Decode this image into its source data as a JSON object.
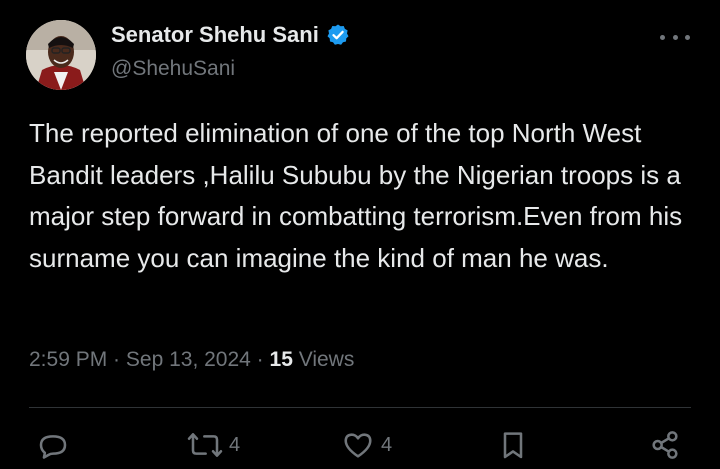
{
  "author": {
    "name": "Senator Shehu Sani",
    "handle": "@ShehuSani",
    "verified": true
  },
  "tweet": {
    "text": "The reported elimination of one of the top North West Bandit leaders ,Halilu Sububu by the Nigerian troops is a major step forward in combatting terrorism.Even from his surname you can imagine the kind of man he was."
  },
  "meta": {
    "time": "2:59 PM",
    "sep1": " · ",
    "date": "Sep 13, 2024",
    "sep2": " · ",
    "views_count": "15",
    "views_label": " Views"
  },
  "actions": {
    "reply_count": "",
    "retweet_count": "4",
    "like_count": "4"
  },
  "icons": {
    "more": "more-dots-icon",
    "verified": "verified-badge-icon",
    "reply": "reply-icon",
    "retweet": "retweet-icon",
    "like": "heart-icon",
    "bookmark": "bookmark-icon",
    "share": "share-icon"
  },
  "colors": {
    "background": "#000000",
    "text": "#e7e9ea",
    "secondary": "#71767b",
    "verified": "#1d9bf0",
    "divider": "#2f3336"
  }
}
